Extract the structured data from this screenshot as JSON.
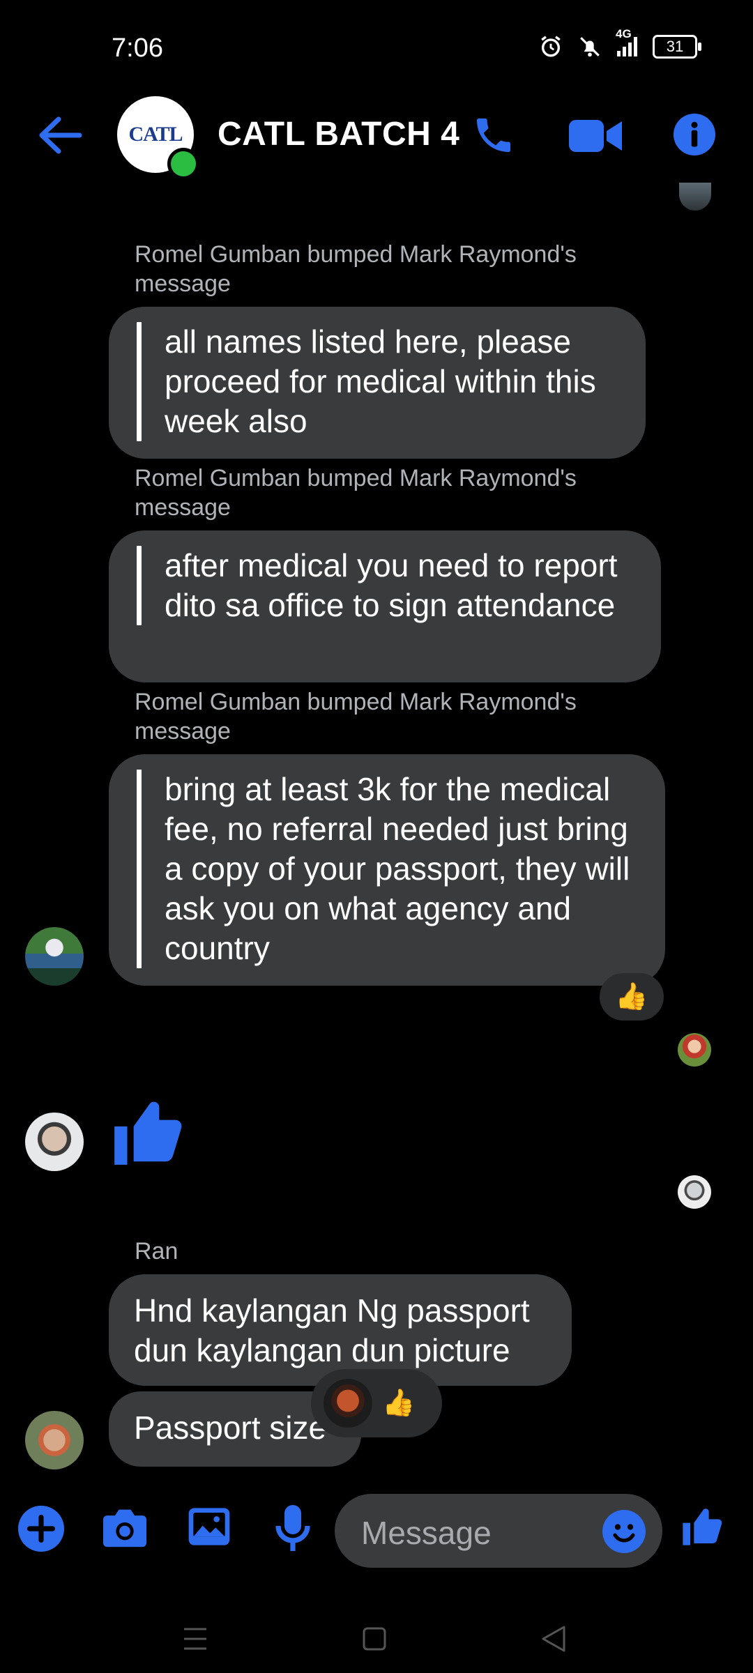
{
  "status_bar": {
    "time": "7:06",
    "network": "4G",
    "battery": "31"
  },
  "header": {
    "title": "CATL BATCH 4",
    "avatar_text": "CATL"
  },
  "messages": [
    {
      "bump": "Romel Gumban bumped Mark Raymond's message",
      "text": "all names listed here, please proceed for medical within this week also"
    },
    {
      "bump": "Romel Gumban bumped Mark Raymond's message",
      "text": "after medical you need to report dito sa office to sign attendance"
    },
    {
      "bump": "Romel Gumban bumped Mark Raymond's message",
      "text": "bring at least 3k for the medical fee, no referral needed just bring a copy of your passport, they will ask you on what agency and country",
      "reaction": "👍"
    }
  ],
  "ran": {
    "sender": "Ran",
    "msg1": "Hnd kaylangan Ng passport dun kaylangan dun picture",
    "msg2": "Passport size",
    "reaction": "👍"
  },
  "composer": {
    "placeholder": "Message"
  },
  "colors": {
    "accent": "#2f6df0",
    "bubble": "#3a3b3c",
    "online": "#2bbd41"
  }
}
